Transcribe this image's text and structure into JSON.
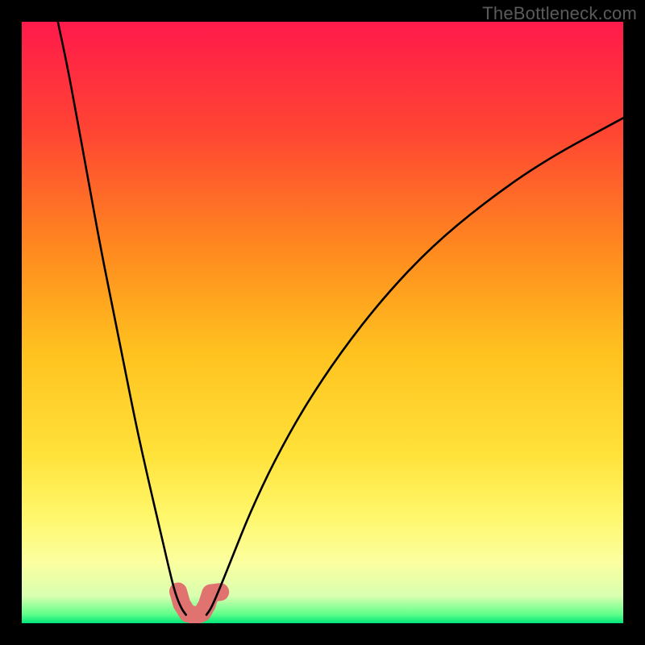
{
  "watermark": "TheBottleneck.com",
  "chart_data": {
    "type": "line",
    "title": "",
    "xlabel": "",
    "ylabel": "",
    "xlim": [
      0,
      100
    ],
    "ylim": [
      0,
      100
    ],
    "grid": false,
    "legend": false,
    "background_gradient": {
      "direction": "vertical",
      "stops": [
        {
          "pos": 0.0,
          "color": "#ff1a4b"
        },
        {
          "pos": 0.18,
          "color": "#ff4433"
        },
        {
          "pos": 0.38,
          "color": "#ff8a1f"
        },
        {
          "pos": 0.55,
          "color": "#ffc21f"
        },
        {
          "pos": 0.72,
          "color": "#ffe23a"
        },
        {
          "pos": 0.82,
          "color": "#fff76a"
        },
        {
          "pos": 0.9,
          "color": "#fbffa0"
        },
        {
          "pos": 0.955,
          "color": "#d8ffb0"
        },
        {
          "pos": 0.985,
          "color": "#61ff8a"
        },
        {
          "pos": 1.0,
          "color": "#00e57a"
        }
      ]
    },
    "series": [
      {
        "name": "left-branch",
        "stroke": "#000000",
        "points": [
          {
            "x": 6.0,
            "y": 100.0
          },
          {
            "x": 7.5,
            "y": 93.0
          },
          {
            "x": 9.0,
            "y": 85.0
          },
          {
            "x": 11.0,
            "y": 74.0
          },
          {
            "x": 13.0,
            "y": 63.0
          },
          {
            "x": 15.0,
            "y": 53.0
          },
          {
            "x": 17.0,
            "y": 43.0
          },
          {
            "x": 19.0,
            "y": 33.0
          },
          {
            "x": 21.0,
            "y": 24.0
          },
          {
            "x": 23.0,
            "y": 15.5
          },
          {
            "x": 24.5,
            "y": 9.0
          },
          {
            "x": 25.5,
            "y": 5.0
          },
          {
            "x": 26.5,
            "y": 2.5
          },
          {
            "x": 27.3,
            "y": 1.4
          }
        ]
      },
      {
        "name": "right-branch",
        "stroke": "#000000",
        "points": [
          {
            "x": 30.7,
            "y": 1.4
          },
          {
            "x": 31.5,
            "y": 2.5
          },
          {
            "x": 33.0,
            "y": 6.0
          },
          {
            "x": 35.0,
            "y": 11.0
          },
          {
            "x": 38.0,
            "y": 18.5
          },
          {
            "x": 42.0,
            "y": 27.0
          },
          {
            "x": 47.0,
            "y": 36.0
          },
          {
            "x": 53.0,
            "y": 45.0
          },
          {
            "x": 60.0,
            "y": 54.0
          },
          {
            "x": 68.0,
            "y": 62.5
          },
          {
            "x": 77.0,
            "y": 70.0
          },
          {
            "x": 87.0,
            "y": 77.0
          },
          {
            "x": 100.0,
            "y": 84.0
          }
        ]
      }
    ],
    "markers": [
      {
        "name": "valley-blob",
        "fill": "#e0736f",
        "points": [
          {
            "x": 26.0,
            "y": 5.3
          },
          {
            "x": 26.6,
            "y": 3.2
          },
          {
            "x": 27.6,
            "y": 1.6
          },
          {
            "x": 29.0,
            "y": 1.3
          },
          {
            "x": 30.0,
            "y": 1.7
          },
          {
            "x": 30.8,
            "y": 3.1
          },
          {
            "x": 31.4,
            "y": 5.0
          },
          {
            "x": 33.0,
            "y": 5.2
          }
        ]
      }
    ]
  }
}
